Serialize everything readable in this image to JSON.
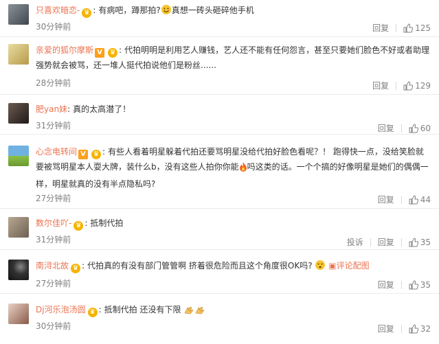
{
  "comments": [
    {
      "username": "只喜欢暗恋-",
      "vip": false,
      "badge": true,
      "text_parts": [
        "有病吧，蹲那拍?",
        "真想一砖头砸碎他手机"
      ],
      "time": "30分钟前",
      "actions": [
        "回复"
      ],
      "likes": "125",
      "avatar_color": "#5b6570"
    },
    {
      "username": "亲爱的狐尔摩斯",
      "vip": true,
      "badge": true,
      "text": "代拍明明是利用艺人赚钱，艺人还不能有任何怨言，甚至只要她们脸色不好或者助理强势就会被骂，还一堆人挺代拍说他们是粉丝......",
      "time": "28分钟前",
      "actions": [
        "回复"
      ],
      "likes": "129",
      "avatar_color": "#d8c47a"
    },
    {
      "username": "肥yan妹",
      "vip": false,
      "badge": false,
      "text": "真的太高潜了！",
      "time": "31分钟前",
      "actions": [
        "回复"
      ],
      "likes": "60",
      "avatar_color": "#3b2f2a"
    },
    {
      "username": "心念电转间",
      "vip": true,
      "badge": true,
      "text_parts": [
        "有些人看着明星躲着代拍还要骂明星没给代拍好脸色看呢？！ 跑得快一点，没给笑脸就要被骂明星本人耍大牌，装什么b，没有这些人拍你你能",
        "吗这类的话。一个个搞的好像明星是她们的偶偶一样，明星就真的没有半点隐私吗?"
      ],
      "time": "27分钟前",
      "actions": [
        "回复"
      ],
      "likes": "44",
      "avatar_color": "#7fb24a"
    },
    {
      "username": "数尔佳吖-",
      "vip": false,
      "badge": true,
      "text": "抵制代拍",
      "time": "31分钟前",
      "actions": [
        "投诉",
        "回复"
      ],
      "likes": "35",
      "avatar_color": "#9a8a76"
    },
    {
      "username": "南浔北故",
      "vip": false,
      "badge": true,
      "text": "代拍真的有没有部门管管啊 挤着很危险而且这个角度很OK吗?",
      "link": "评论配图",
      "time": "27分钟前",
      "actions": [
        "回复"
      ],
      "likes": "35",
      "avatar_color": "#2a2a2a"
    },
    {
      "username": "Dj河乐泡汤圆",
      "vip": false,
      "badge": true,
      "text": "抵制代拍 还没有下限",
      "time": "30分钟前",
      "actions": [
        "回复"
      ],
      "likes": "32",
      "avatar_color": "#c9a08b"
    }
  ]
}
